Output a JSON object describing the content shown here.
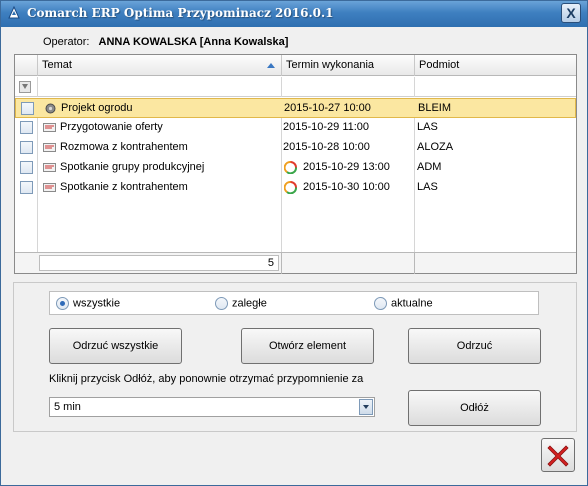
{
  "window": {
    "title": "Comarch ERP Optima Przypominacz 2016.0.1",
    "close_glyph": "X"
  },
  "operator": {
    "label": "Operator:",
    "name": "ANNA KOWALSKA [Anna Kowalska]"
  },
  "grid": {
    "columns": [
      "Temat",
      "Termin wykonania",
      "Podmiot"
    ],
    "sort_column": "Temat",
    "rows": [
      {
        "topic": "Projekt ogrodu",
        "term": "2015-10-27 10:00",
        "subject": "BLEIM",
        "icon": "task-icon",
        "overdue": false,
        "selected": true
      },
      {
        "topic": "Przygotowanie oferty",
        "term": "2015-10-29 11:00",
        "subject": "LAS",
        "icon": "note-icon",
        "overdue": false,
        "selected": false
      },
      {
        "topic": "Rozmowa z kontrahentem",
        "term": "2015-10-28 10:00",
        "subject": "ALOZA",
        "icon": "note-icon",
        "overdue": false,
        "selected": false
      },
      {
        "topic": "Spotkanie grupy produkcyjnej",
        "term": "2015-10-29 13:00",
        "subject": "ADM",
        "icon": "note-icon",
        "overdue": true,
        "selected": false
      },
      {
        "topic": "Spotkanie z kontrahentem",
        "term": "2015-10-30 10:00",
        "subject": "LAS",
        "icon": "note-icon",
        "overdue": true,
        "selected": false
      }
    ],
    "count": "5"
  },
  "filter": {
    "options": [
      "wszystkie",
      "zaległe",
      "aktualne"
    ],
    "selected": "wszystkie"
  },
  "buttons": {
    "reject_all": "Odrzuć wszystkie",
    "open_element": "Otwórz element",
    "reject": "Odrzuć",
    "snooze": "Odłóż"
  },
  "snooze": {
    "hint": "Kliknij przycisk Odłóż, aby ponownie otrzymać przypomnienie za",
    "value": "5 min"
  },
  "colors": {
    "selection": "#fbe7a1",
    "titlebar": "#3e7fc0",
    "exit_icon": "#d42020"
  }
}
